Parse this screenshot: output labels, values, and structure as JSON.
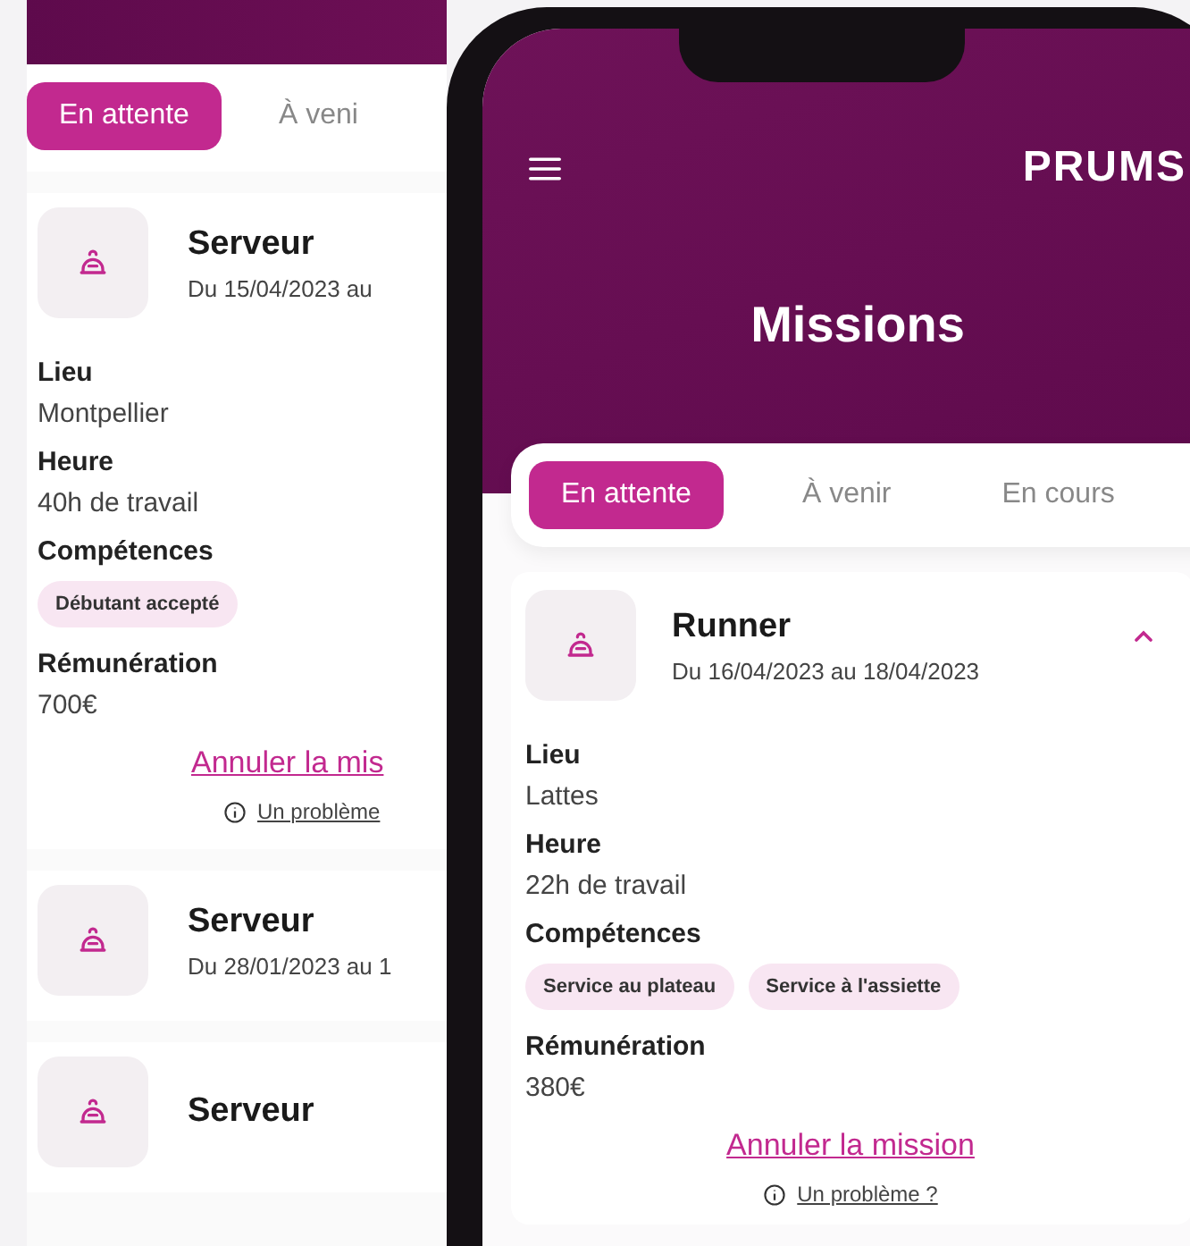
{
  "back_screen": {
    "tabs": [
      {
        "label": "En attente",
        "selected": true
      },
      {
        "label": "À veni",
        "selected": false
      }
    ],
    "missions": [
      {
        "title": "Serveur",
        "dates": "Du 15/04/2023 au",
        "expanded": true,
        "location_label": "Lieu",
        "location": "Montpellier",
        "hours_label": "Heure",
        "hours": "40h de travail",
        "skills_label": "Compétences",
        "skills": [
          "Débutant accepté"
        ],
        "pay_label": "Rémunération",
        "pay": "700€",
        "cancel_link": "Annuler la mis",
        "problem_link": "Un problème"
      },
      {
        "title": "Serveur",
        "dates": "Du 28/01/2023 au 1",
        "expanded": false
      },
      {
        "title": "Serveur",
        "expanded": false
      }
    ]
  },
  "phone": {
    "logo": "PRUMS",
    "title": "Missions",
    "tabs": [
      {
        "label": "En attente",
        "selected": true
      },
      {
        "label": "À venir",
        "selected": false
      },
      {
        "label": "En cours",
        "selected": false
      }
    ],
    "missions": [
      {
        "title": "Runner",
        "dates": "Du 16/04/2023 au 18/04/2023",
        "expanded": true,
        "location_label": "Lieu",
        "location": "Lattes",
        "hours_label": "Heure",
        "hours": "22h de travail",
        "skills_label": "Compétences",
        "skills": [
          "Service au plateau",
          "Service à l'assiette"
        ],
        "pay_label": "Rémunération",
        "pay": "380€",
        "cancel_link": "Annuler la mission",
        "problem_link": "Un problème ?"
      }
    ]
  }
}
